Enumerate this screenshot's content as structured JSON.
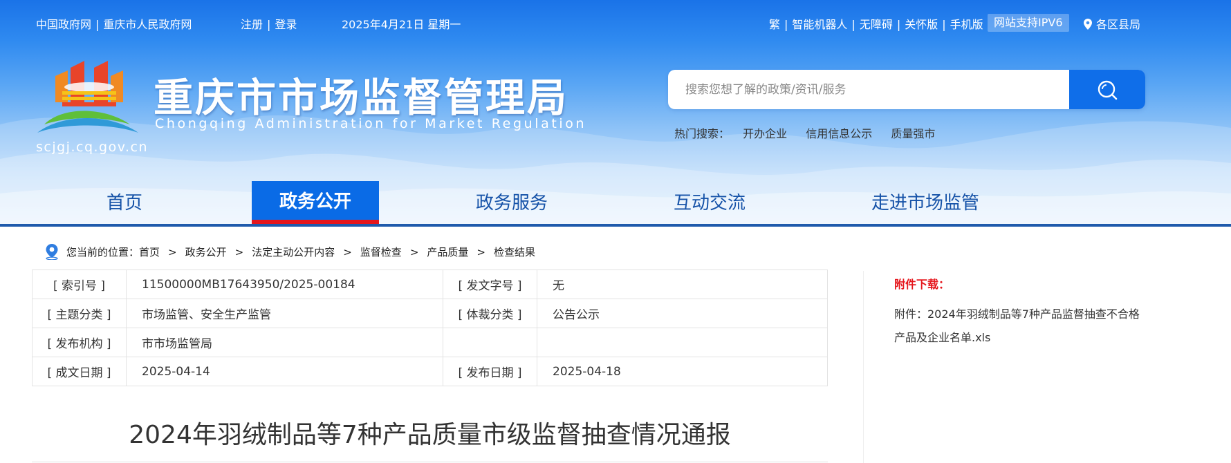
{
  "topbar": {
    "gov_links": [
      "中国政府网",
      "重庆市人民政府网"
    ],
    "auth_links": [
      "注册",
      "登录"
    ],
    "date": "2025年4月21日 星期一",
    "tools": [
      "繁",
      "智能机器人",
      "无障碍",
      "关怀版",
      "手机版"
    ],
    "ipv6": "网站支持IPV6",
    "region": "各区县局"
  },
  "site": {
    "title": "重庆市市场监督管理局",
    "subtitle": "Chongqing  Administration for Market Regulation",
    "domain": "scjgj.cq.gov.cn"
  },
  "search": {
    "placeholder": "搜索您想了解的政策/资讯/服务",
    "hot_label": "热门搜索：",
    "hot_links": [
      "开办企业",
      "信用信息公示",
      "质量强市"
    ]
  },
  "nav": {
    "items": [
      "首页",
      "政务公开",
      "政务服务",
      "互动交流",
      "走进市场监管"
    ],
    "active": "政务公开"
  },
  "breadcrumb": {
    "label": "您当前的位置：",
    "items": [
      "首页",
      "政务公开",
      "法定主动公开内容",
      "监督检查",
      "产品质量",
      "检查结果"
    ]
  },
  "info": {
    "index_no_label": "[ 索引号 ]",
    "index_no": "11500000MB17643950/2025-00184",
    "doc_no_label": "[ 发文字号 ]",
    "doc_no": "无",
    "topic_label": "[ 主题分类 ]",
    "topic": "市场监管、安全生产监管",
    "genre_label": "[ 体裁分类 ]",
    "genre": "公告公示",
    "org_label": "[ 发布机构 ]",
    "org": "市市场监管局",
    "created_label": "[ 成文日期 ]",
    "created": "2025-04-14",
    "published_label": "[ 发布日期 ]",
    "published": "2025-04-18"
  },
  "article": {
    "title": "2024年羽绒制品等7种产品质量市级监督抽查情况通报"
  },
  "attachments": {
    "heading": "附件下载：",
    "items": [
      "附件：2024年羽绒制品等7种产品监督抽查不合格产品及企业名单.xls"
    ]
  },
  "colors": {
    "nav_active_bg": "#0a6be6",
    "nav_active_underline": "#e5161c",
    "nav_text": "#1552a8",
    "attachment_heading": "#e5161c"
  }
}
